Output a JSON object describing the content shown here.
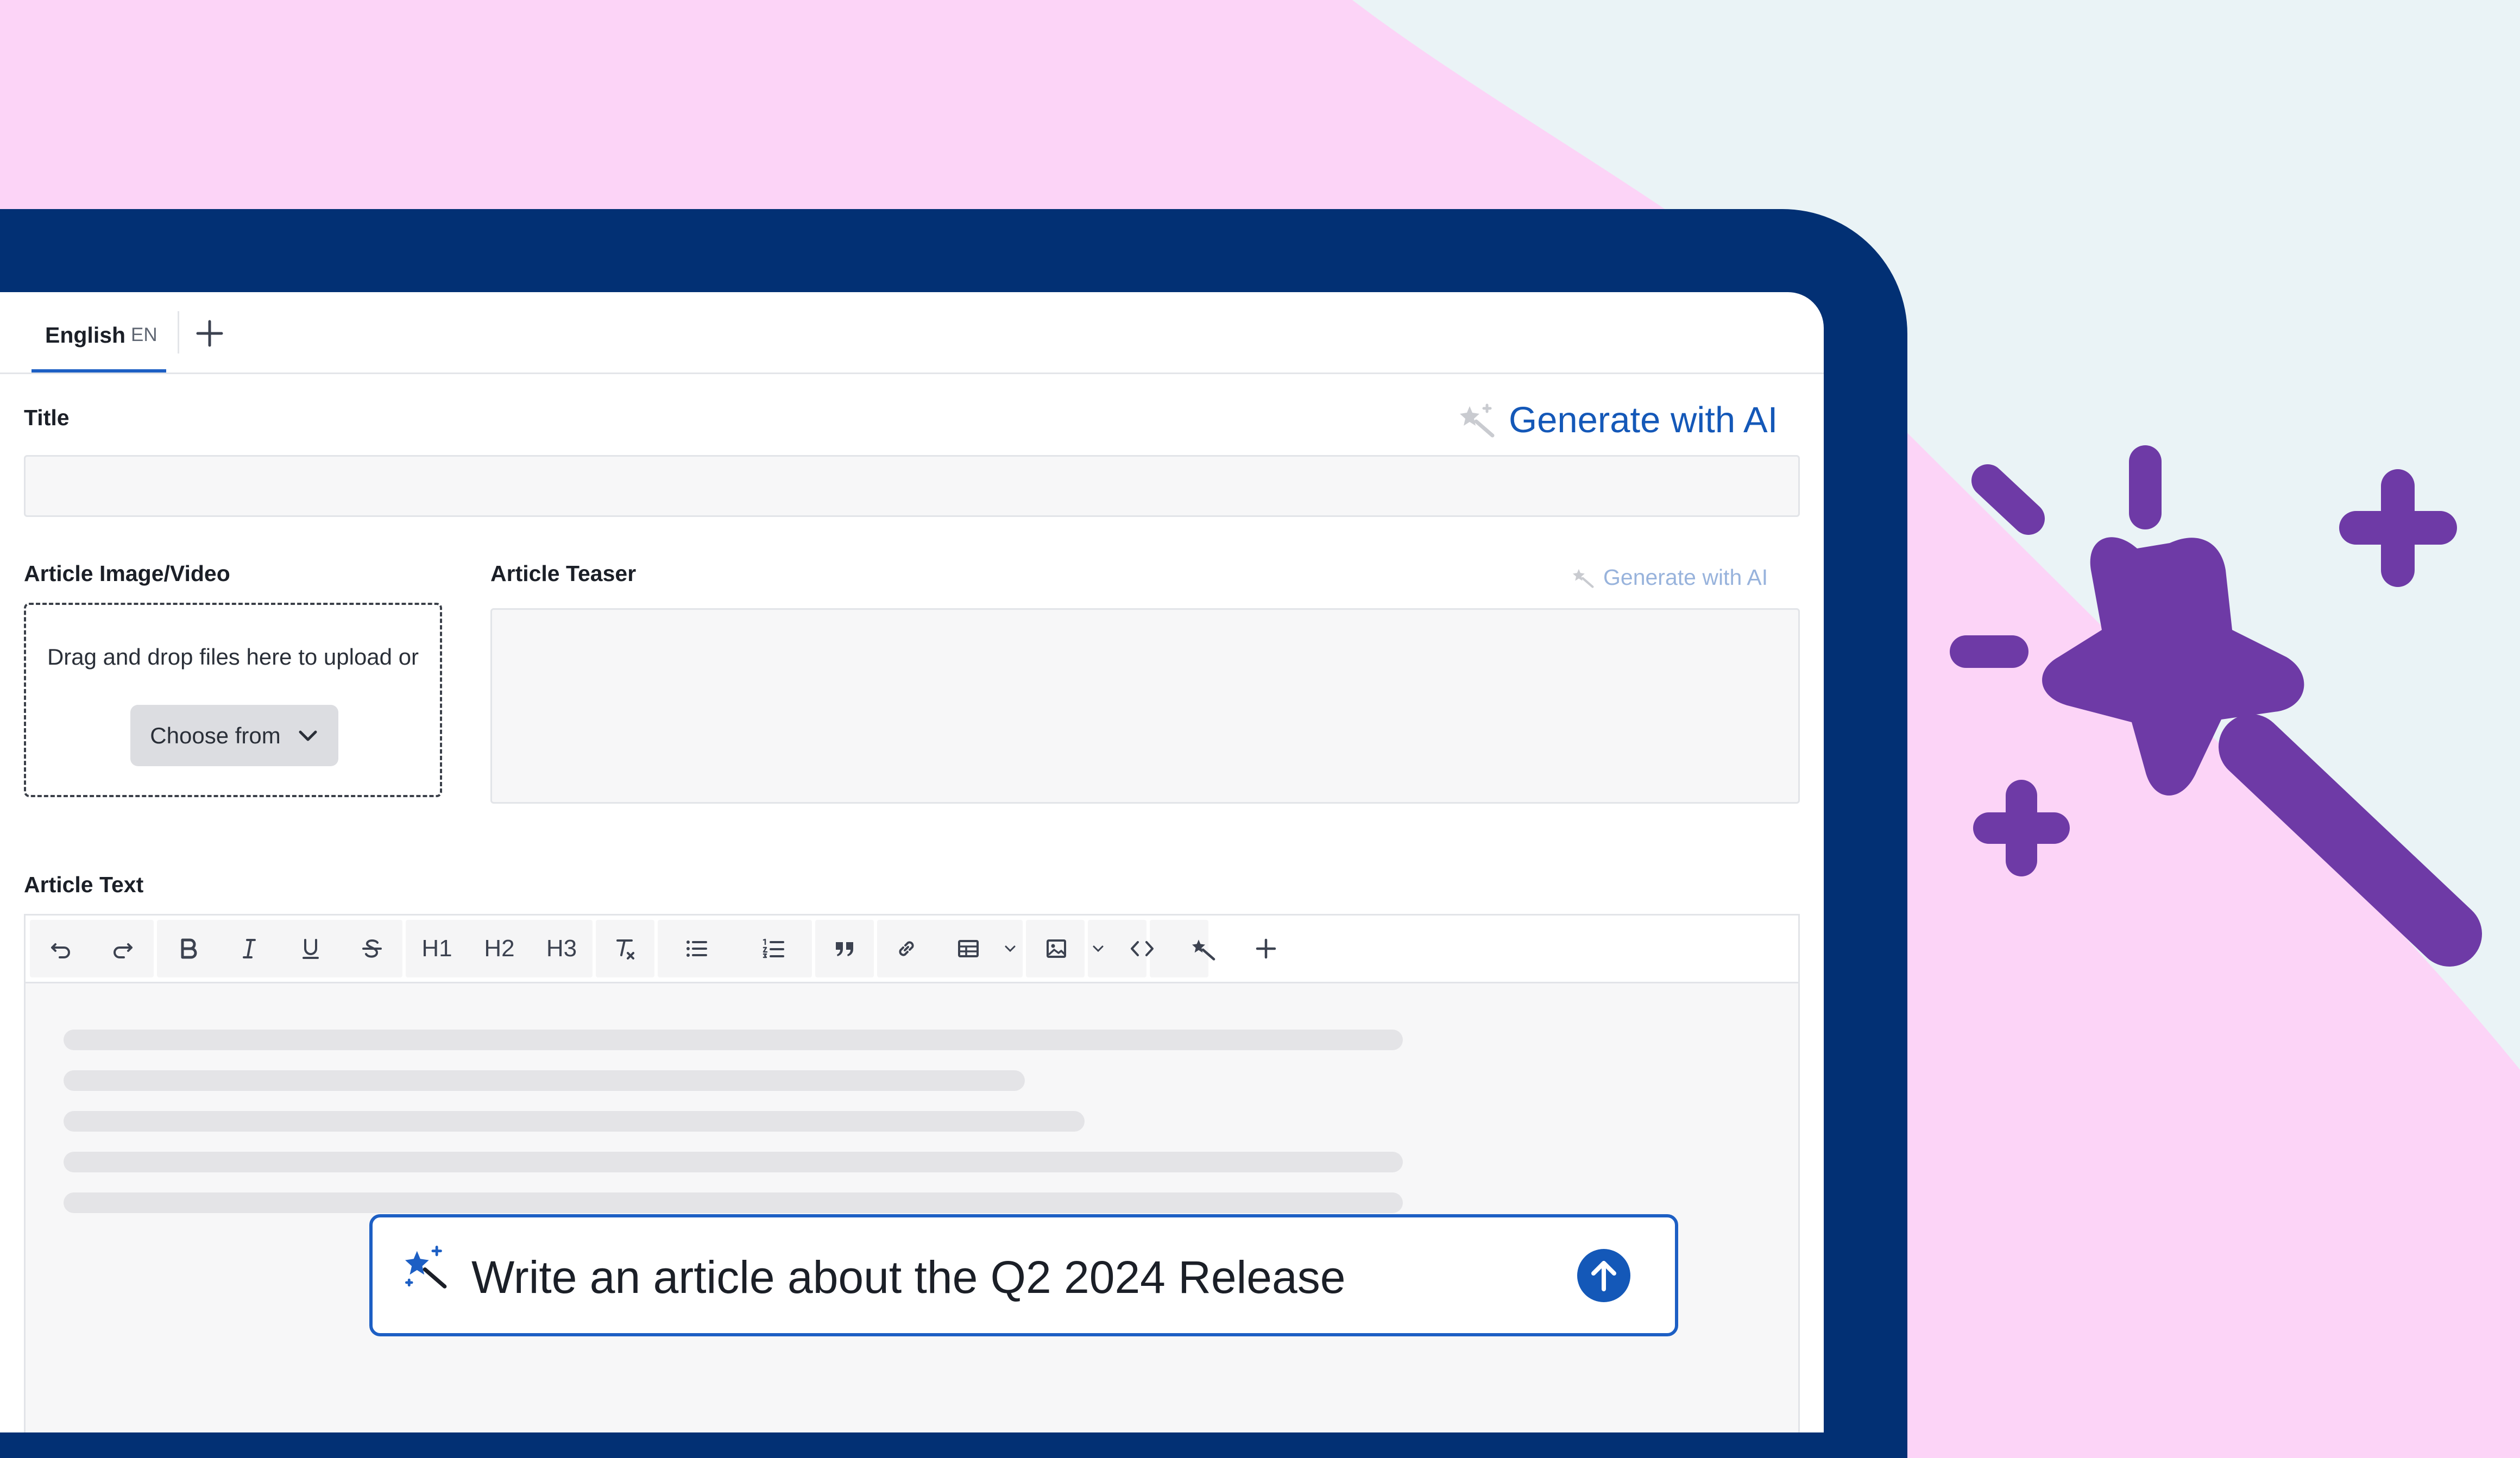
{
  "tabs": {
    "active_label": "English",
    "active_code": "EN"
  },
  "fields": {
    "title_label": "Title",
    "generate_ai_label": "Generate with AI",
    "media_label": "Article Image/Video",
    "teaser_label": "Article Teaser",
    "teaser_generate_label": "Generate with AI",
    "text_label": "Article Text"
  },
  "dropzone": {
    "text": "Drag and drop files here to upload or",
    "choose_label": "Choose from"
  },
  "toolbar": {
    "h1": "H1",
    "h2": "H2",
    "h3": "H3"
  },
  "prompt": {
    "value": "Write an article about the Q2 2024 Release"
  },
  "colors": {
    "brand_navy": "#023074",
    "accent_blue": "#1d5fc4",
    "magic_purple": "#6e3aa6",
    "background_pink": "#fcd4f7",
    "background_light": "#eaf3f6"
  }
}
